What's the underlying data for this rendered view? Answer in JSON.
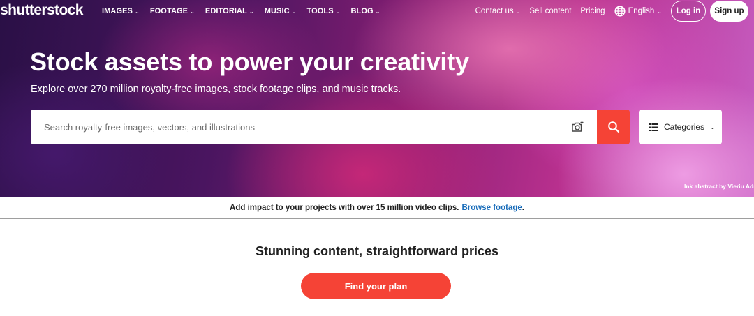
{
  "logo": "shutterstock",
  "nav": {
    "primary": [
      {
        "label": "IMAGES"
      },
      {
        "label": "FOOTAGE"
      },
      {
        "label": "EDITORIAL"
      },
      {
        "label": "MUSIC"
      },
      {
        "label": "TOOLS"
      },
      {
        "label": "BLOG"
      }
    ],
    "contact": "Contact us",
    "sell": "Sell content",
    "pricing": "Pricing",
    "language": "English",
    "login": "Log in",
    "signup": "Sign up"
  },
  "hero": {
    "headline": "Stock assets to power your creativity",
    "subline": "Explore over 270 million royalty-free images, stock footage clips, and music tracks.",
    "credit": "Ink abstract by Vieriu Adr"
  },
  "search": {
    "placeholder": "Search royalty-free images, vectors, and illustrations",
    "value": "",
    "categories_label": "Categories"
  },
  "banner": {
    "text": "Add impact to your projects with over 15 million video clips.",
    "link": "Browse footage",
    "suffix": "."
  },
  "pricing": {
    "title": "Stunning content, straightforward prices",
    "button": "Find your plan"
  },
  "colors": {
    "accent": "#f54336",
    "link": "#1a6dba"
  }
}
